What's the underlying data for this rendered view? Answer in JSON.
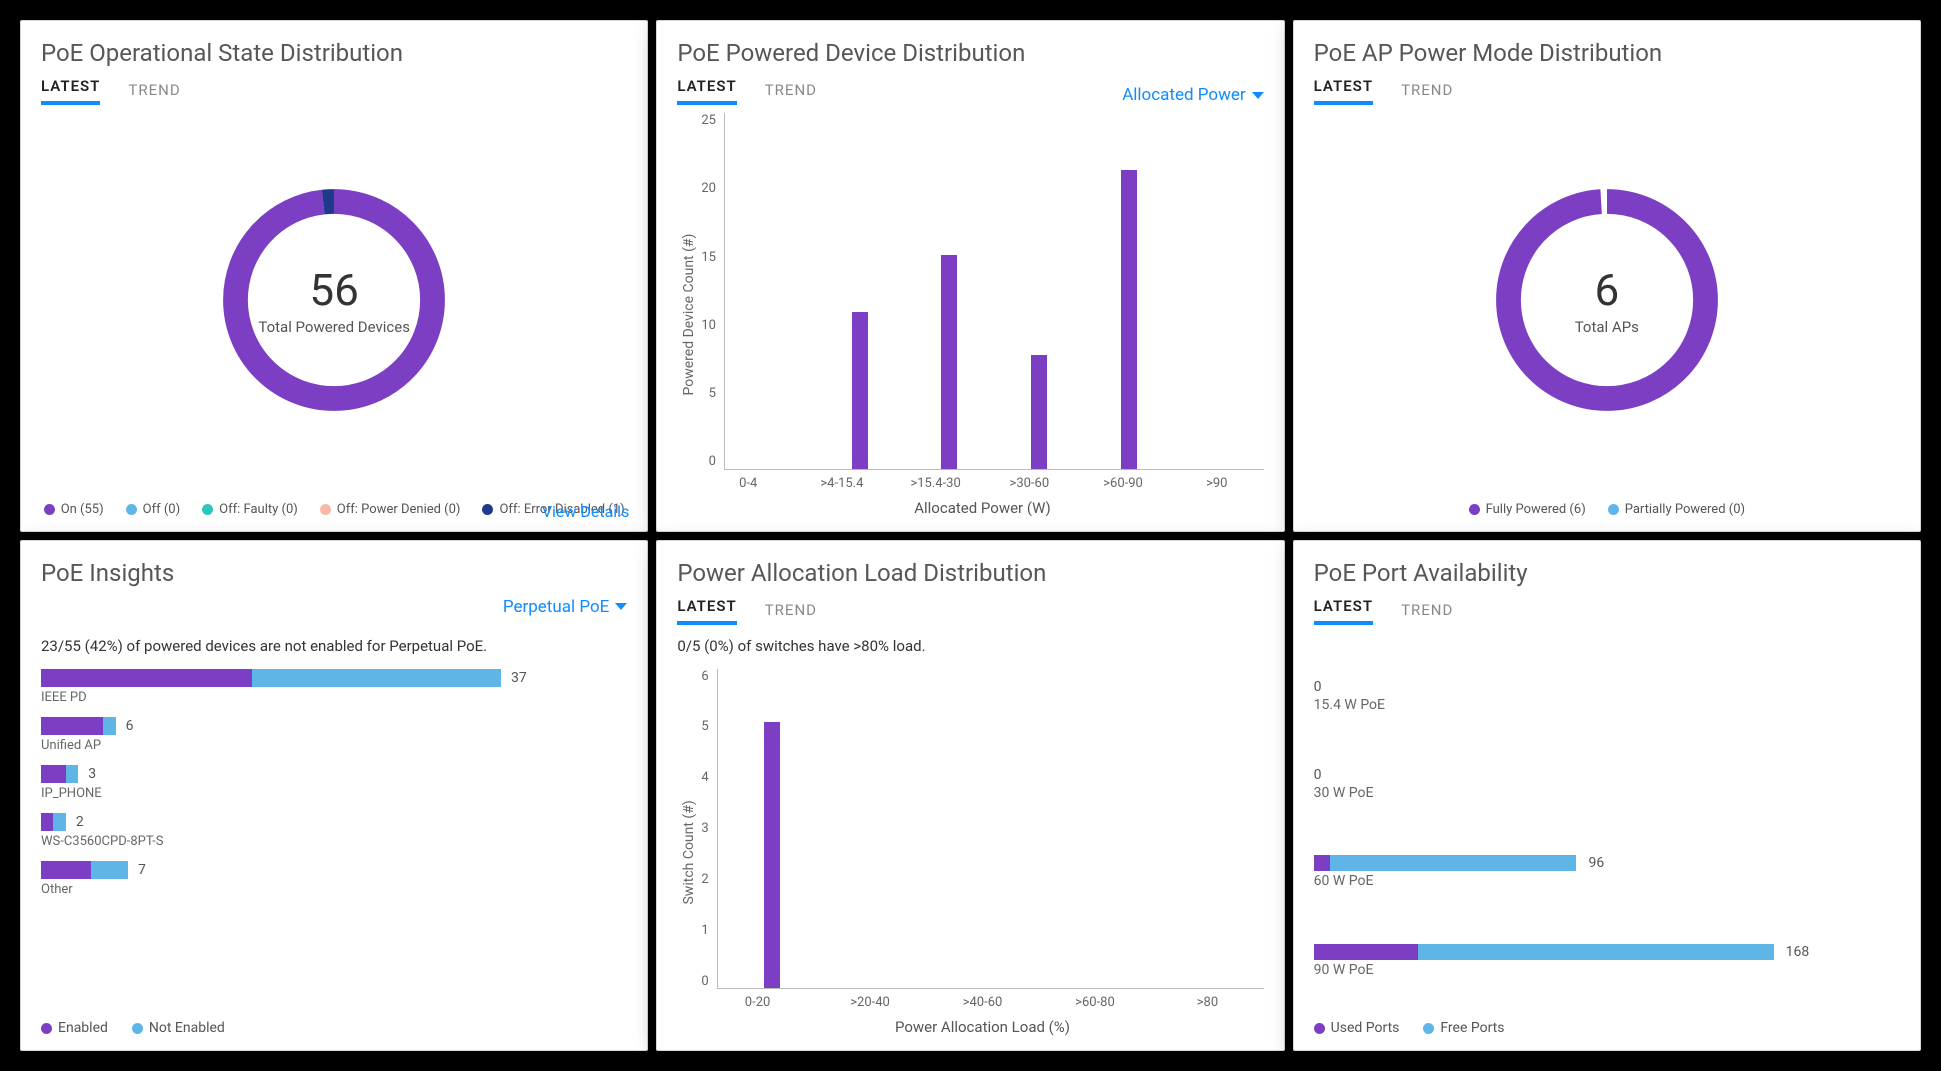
{
  "colors": {
    "purple": "#7c3fc4",
    "lightblue": "#5fb6e6",
    "teal": "#2fc6c0",
    "peach": "#f7b9a3",
    "navy": "#1e3a8a",
    "link": "#0f8cff"
  },
  "tabs": {
    "latest": "LATEST",
    "trend": "TREND"
  },
  "panels": {
    "op_state": {
      "title": "PoE Operational State Distribution",
      "center_value": "56",
      "center_label": "Total Powered Devices",
      "legend": [
        {
          "label": "On (55)",
          "color": "#7c3fc4"
        },
        {
          "label": "Off (0)",
          "color": "#5fb6e6"
        },
        {
          "label": "Off: Faulty (0)",
          "color": "#2fc6c0"
        },
        {
          "label": "Off: Power Denied (0)",
          "color": "#f7b9a3"
        },
        {
          "label": "Off: Error Disabled (1)",
          "color": "#1e3a8a"
        }
      ],
      "view_details": "View Details"
    },
    "powered_device": {
      "title": "PoE Powered Device Distribution",
      "dropdown": "Allocated Power",
      "ylabel": "Powered Device Count (#)",
      "xlabel": "Allocated Power (W)"
    },
    "ap_power": {
      "title": "PoE AP Power Mode Distribution",
      "center_value": "6",
      "center_label": "Total APs",
      "legend": [
        {
          "label": "Fully Powered (6)",
          "color": "#7c3fc4"
        },
        {
          "label": "Partially Powered (0)",
          "color": "#5fb6e6"
        }
      ]
    },
    "insights": {
      "title": "PoE Insights",
      "dropdown": "Perpetual PoE",
      "summary": "23/55 (42%) of powered devices are not enabled for Perpetual PoE.",
      "legend": [
        {
          "label": "Enabled",
          "color": "#7c3fc4"
        },
        {
          "label": "Not Enabled",
          "color": "#5fb6e6"
        }
      ]
    },
    "load_dist": {
      "title": "Power Allocation Load Distribution",
      "summary": "0/5 (0%) of switches have >80% load.",
      "ylabel": "Switch Count (#)",
      "xlabel": "Power Allocation Load (%)"
    },
    "port_avail": {
      "title": "PoE Port Availability",
      "legend": [
        {
          "label": "Used Ports",
          "color": "#7c3fc4"
        },
        {
          "label": "Free Ports",
          "color": "#5fb6e6"
        }
      ]
    }
  },
  "chart_data": [
    {
      "id": "op_state",
      "type": "pie",
      "title": "PoE Operational State Distribution",
      "total": 56,
      "series": [
        {
          "name": "On",
          "value": 55,
          "color": "#7c3fc4"
        },
        {
          "name": "Off",
          "value": 0,
          "color": "#5fb6e6"
        },
        {
          "name": "Off: Faulty",
          "value": 0,
          "color": "#2fc6c0"
        },
        {
          "name": "Off: Power Denied",
          "value": 0,
          "color": "#f7b9a3"
        },
        {
          "name": "Off: Error Disabled",
          "value": 1,
          "color": "#1e3a8a"
        }
      ]
    },
    {
      "id": "powered_device",
      "type": "bar",
      "title": "PoE Powered Device Distribution",
      "xlabel": "Allocated Power (W)",
      "ylabel": "Powered Device Count (#)",
      "ylim": [
        0,
        25
      ],
      "yticks": [
        0,
        5,
        10,
        15,
        20,
        25
      ],
      "categories": [
        "0-4",
        ">4-15.4",
        ">15.4-30",
        ">30-60",
        ">60-90",
        ">90"
      ],
      "values": [
        0,
        11,
        15,
        8,
        21,
        0
      ]
    },
    {
      "id": "ap_power",
      "type": "pie",
      "title": "PoE AP Power Mode Distribution",
      "total": 6,
      "series": [
        {
          "name": "Fully Powered",
          "value": 6,
          "color": "#7c3fc4"
        },
        {
          "name": "Partially Powered",
          "value": 0,
          "color": "#5fb6e6"
        }
      ]
    },
    {
      "id": "insights",
      "type": "bar",
      "orientation": "horizontal-stacked",
      "title": "PoE Insights — Perpetual PoE",
      "max": 37,
      "categories": [
        "IEEE PD",
        "Unified AP",
        "IP_PHONE",
        "WS-C3560CPD-8PT-S",
        "Other"
      ],
      "series": [
        {
          "name": "Enabled",
          "color": "#7c3fc4",
          "values": [
            17,
            5,
            2,
            1,
            4
          ]
        },
        {
          "name": "Not Enabled",
          "color": "#5fb6e6",
          "values": [
            20,
            1,
            1,
            1,
            3
          ]
        }
      ],
      "totals": [
        37,
        6,
        3,
        2,
        7
      ]
    },
    {
      "id": "load_dist",
      "type": "bar",
      "title": "Power Allocation Load Distribution",
      "xlabel": "Power Allocation Load (%)",
      "ylabel": "Switch Count (#)",
      "ylim": [
        0,
        6
      ],
      "yticks": [
        0,
        1,
        2,
        3,
        4,
        5,
        6
      ],
      "categories": [
        "0-20",
        ">20-40",
        ">40-60",
        ">60-80",
        ">80"
      ],
      "values": [
        5,
        0,
        0,
        0,
        0
      ]
    },
    {
      "id": "port_avail",
      "type": "bar",
      "orientation": "horizontal-stacked",
      "title": "PoE Port Availability",
      "max": 168,
      "categories": [
        "15.4 W PoE",
        "30 W PoE",
        "60 W PoE",
        "90 W PoE"
      ],
      "series": [
        {
          "name": "Used Ports",
          "color": "#7c3fc4",
          "values": [
            0,
            0,
            6,
            38
          ]
        },
        {
          "name": "Free Ports",
          "color": "#5fb6e6",
          "values": [
            0,
            0,
            90,
            130
          ]
        }
      ],
      "totals": [
        0,
        0,
        96,
        168
      ]
    }
  ]
}
